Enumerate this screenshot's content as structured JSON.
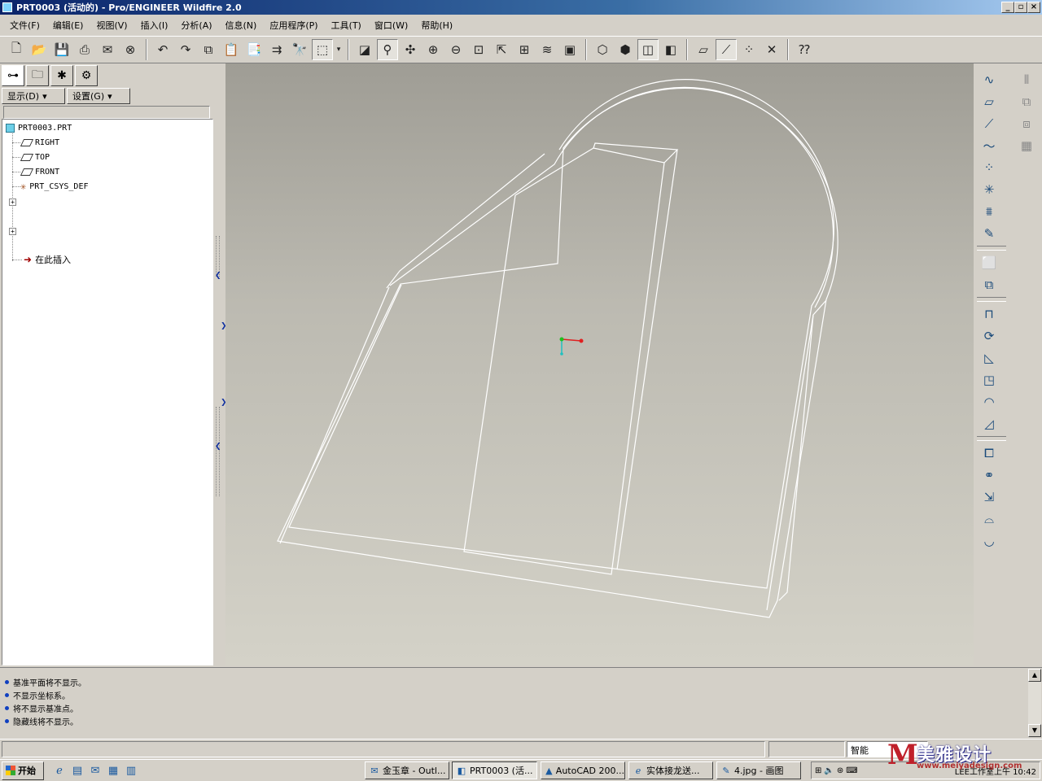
{
  "window": {
    "title": "PRT0003 (活动的) - Pro/ENGINEER Wildfire 2.0",
    "btn_min": "_",
    "btn_restore": "▫",
    "btn_close": "×"
  },
  "menu": [
    "文件(F)",
    "编辑(E)",
    "视图(V)",
    "插入(I)",
    "分析(A)",
    "信息(N)",
    "应用程序(P)",
    "工具(T)",
    "窗口(W)",
    "帮助(H)"
  ],
  "panel": {
    "display_label": "显示(D)",
    "settings_label": "设置(G)",
    "tree": {
      "root": "PRT0003.PRT",
      "items": [
        "RIGHT",
        "TOP",
        "FRONT",
        "PRT_CSYS_DEF"
      ],
      "insert_here": "在此插入"
    }
  },
  "messages": [
    "基准平面将不显示。",
    "不显示坐标系。",
    "将不显示基准点。",
    "隐藏线将不显示。"
  ],
  "status": {
    "filter": "智能"
  },
  "taskbar": {
    "start": "开始",
    "tasks": [
      "金玉章 - Outl...",
      "PRT0003 (活...",
      "AutoCAD 200...",
      "实体接龙送...",
      "4.jpg - 画图"
    ],
    "tray_text": "LEE工作室上午 10:42"
  },
  "watermark": {
    "logo_letter": "M",
    "text": "美雅设计",
    "url": "www.meiyadesign.com"
  },
  "colors": {
    "title_bar": "#0a246a",
    "viewport_top": "#9f9d95",
    "viewport_bottom": "#d4d2c8",
    "model_edges": "#ffffff",
    "csys_x": "#e02020",
    "csys_y": "#20c020",
    "csys_z": "#20c0c0"
  },
  "icons": {
    "toolbar": [
      "new-icon",
      "open-icon",
      "save-icon",
      "print-icon",
      "send-icon",
      "close-window-icon",
      "undo-icon",
      "redo-icon",
      "copy-icon",
      "paste-icon",
      "paste-special-icon",
      "regenerate-icon",
      "find-icon",
      "select-box-icon",
      "repaint-icon",
      "spin-center-icon",
      "orient-icon",
      "zoom-in-icon",
      "zoom-out-icon",
      "refit-icon",
      "saved-views-icon",
      "named-view-icon",
      "layers-icon",
      "view-manager-icon",
      "wireframe-icon",
      "hidden-line-icon",
      "no-hidden-icon",
      "shaded-icon",
      "datum-planes-icon",
      "datum-axes-icon",
      "datum-points-icon",
      "csys-icon",
      "context-help-icon"
    ]
  }
}
